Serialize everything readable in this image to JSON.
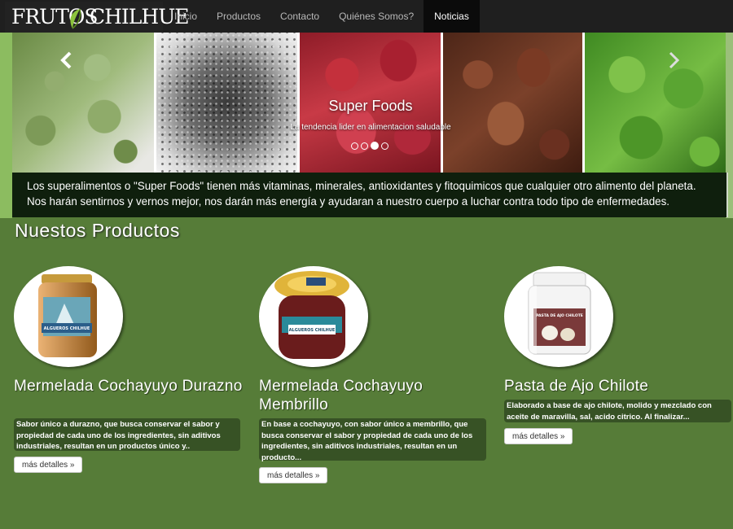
{
  "brand": {
    "left": "FRUTOS",
    "right": "CHILHUE"
  },
  "nav": {
    "items": [
      "Inicio",
      "Productos",
      "Contacto",
      "Quiénes Somos?",
      "Noticias"
    ],
    "active": "Noticias"
  },
  "carousel": {
    "title": "Super Foods",
    "subtitle": "La tendencia lider en alimentacion saludable",
    "prev_icon": "chevron-left-icon",
    "next_icon": "chevron-right-icon",
    "slide_count": 4,
    "active_slide": 3
  },
  "info": {
    "line1": "Los superalimentos o \"Super Foods\" tienen más vitaminas, minerales, antioxidantes y fitoquimicos que cualquier otro alimento del planeta.",
    "line2": "Nos harán sentirnos y vernos mejor, nos darán más energía y ayudaran a nuestro cuerpo a luchar contra todo tipo de enfermedades."
  },
  "section": {
    "title": "Nuestos Productos"
  },
  "products": [
    {
      "name": "Mermelada Cochayuyo Durazno",
      "description": "Sabor único a durazno, que busca conservar el sabor y propiedad de cada uno de los ingredientes, sin aditivos industriales, resultan en un productos único y..",
      "button": "más detalles »",
      "label_text": "ALGUEROS CHILHUE"
    },
    {
      "name": "Mermelada Cochayuyo Membrillo",
      "description": "En base a cochayuyo, con sabor único a membrillo, que busca conservar el sabor y propiedad de cada uno de los ingredientes, sin aditivos industriales, resultan en un producto...",
      "button": "más detalles »",
      "label_text": "ALGUEROS CHILHUE"
    },
    {
      "name": "Pasta de Ajo Chilote",
      "description": "Elaborado a base de ajo chilote, molido y mezclado con aceite de maravilla, sal, acido citrico. Al finalizar...",
      "button": "más detalles »",
      "label_text": "PASTA DE AJO CHILOTE"
    }
  ],
  "colors": {
    "background": "#567c38",
    "navbar": "#1f1f1f",
    "info_box": "#0f1f0d"
  }
}
